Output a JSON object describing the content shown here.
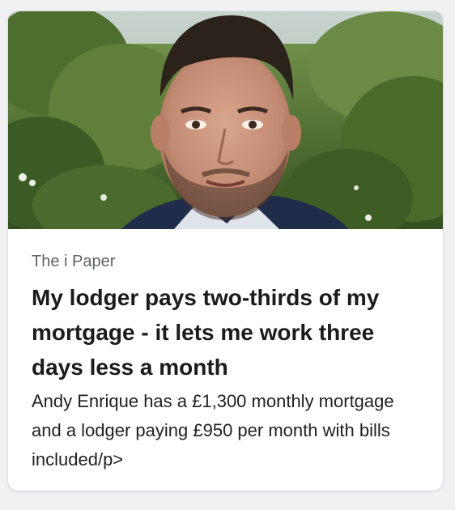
{
  "card": {
    "image_alt": "Man with short dark hair and beard standing in front of green bushes",
    "source": "The i Paper",
    "headline": "My lodger pays two-thirds of my mortgage - it lets me work three days less a month",
    "snippet": "Andy Enrique has a £1,300 monthly mortgage and a lodger paying £950 per month with bills included/p>"
  },
  "colors": {
    "card_bg": "#ffffff",
    "page_bg": "#f1f1f3",
    "source_text": "#5f6368",
    "headline_text": "#1b1b1b",
    "snippet_text": "#202124"
  }
}
